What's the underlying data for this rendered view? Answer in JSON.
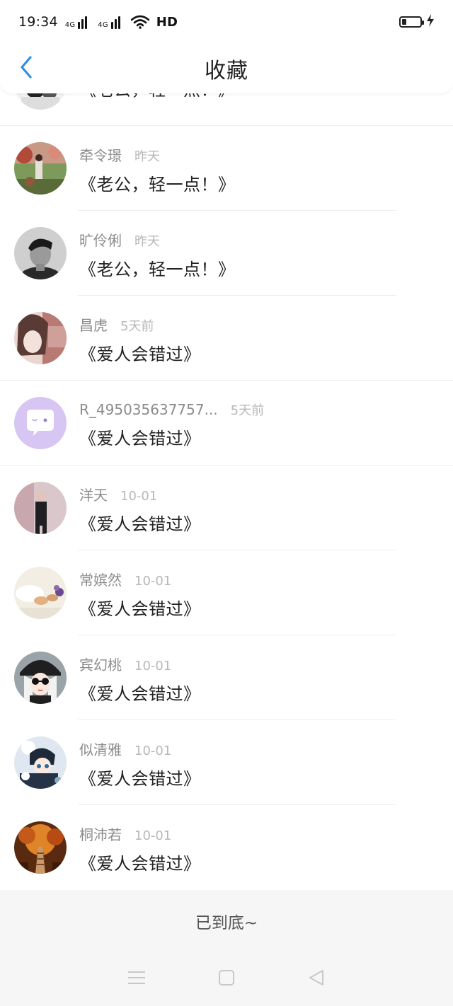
{
  "status_bar": {
    "time": "19:34",
    "network_1": "4G",
    "network_2": "4G",
    "hd_label": "HD",
    "icons": [
      "signal-icon",
      "signal-icon",
      "wifi-icon",
      "battery-icon",
      "charging-icon"
    ]
  },
  "header": {
    "title": "收藏",
    "back_icon": "chevron-left-icon",
    "accent_color": "#2f8ee3"
  },
  "list": {
    "items": [
      {
        "name": "",
        "time": "",
        "title": "《老公，轻一点！》",
        "avatar": "avatar-partial"
      },
      {
        "name": "牵令璟",
        "time": "昨天",
        "title": "《老公，轻一点！》",
        "avatar": "avatar-outdoor-photo"
      },
      {
        "name": "旷伶俐",
        "time": "昨天",
        "title": "《老公，轻一点！》",
        "avatar": "avatar-portrait-bw"
      },
      {
        "name": "昌虎",
        "time": "5天前",
        "title": "《爱人会错过》",
        "avatar": "avatar-girl-photo"
      },
      {
        "name": "R_495035637757...",
        "time": "5天前",
        "title": "《爱人会错过》",
        "avatar": "avatar-default-chat"
      },
      {
        "name": "洋天",
        "time": "10-01",
        "title": "《爱人会错过》",
        "avatar": "avatar-suit-photo"
      },
      {
        "name": "常嫔然",
        "time": "10-01",
        "title": "《爱人会错过》",
        "avatar": "avatar-still-life"
      },
      {
        "name": "宾幻桃",
        "time": "10-01",
        "title": "《爱人会错过》",
        "avatar": "avatar-anime-girl"
      },
      {
        "name": "似清雅",
        "time": "10-01",
        "title": "《爱人会错过》",
        "avatar": "avatar-anime-boy"
      },
      {
        "name": "桐沛若",
        "time": "10-01",
        "title": "《爱人会错过》",
        "avatar": "avatar-forest-bridge"
      }
    ]
  },
  "footer": {
    "end_text": "已到底~"
  },
  "nav_bar": {
    "icons": [
      "menu-icon",
      "home-icon",
      "back-triangle-icon"
    ]
  }
}
